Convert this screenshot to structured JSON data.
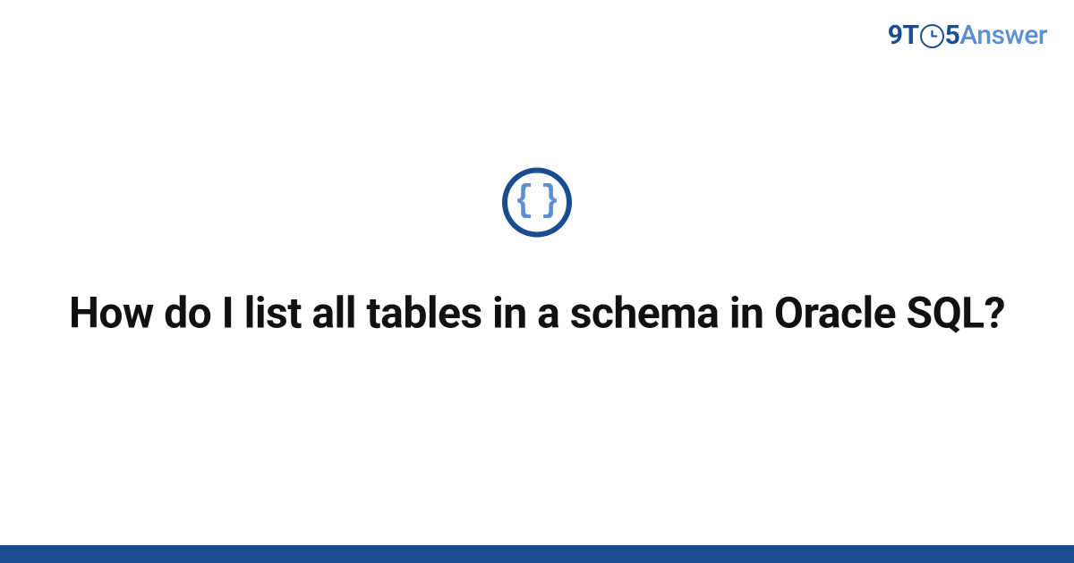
{
  "logo": {
    "part1": "9T",
    "part2": "5",
    "part3": "Answer"
  },
  "icon": {
    "left_brace": "{",
    "right_brace": "}"
  },
  "question_title": "How do I list all tables in a schema in Oracle SQL?",
  "colors": {
    "brand_dark": "#1a4d8f",
    "brand_light": "#5a8fd4",
    "text": "#111111",
    "background": "#ffffff"
  }
}
